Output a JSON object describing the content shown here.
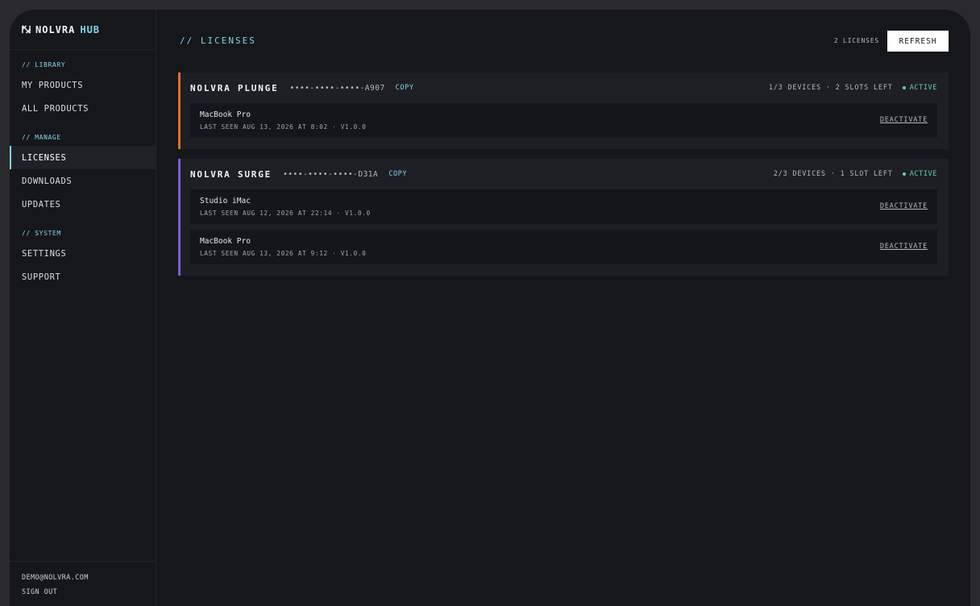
{
  "brand": {
    "name": "NOLVRA",
    "accent": "HUB"
  },
  "sidebar": {
    "sections": [
      {
        "label": "// LIBRARY",
        "items": [
          {
            "label": "MY PRODUCTS"
          },
          {
            "label": "ALL PRODUCTS"
          }
        ]
      },
      {
        "label": "// MANAGE",
        "items": [
          {
            "label": "LICENSES",
            "active": true
          },
          {
            "label": "DOWNLOADS"
          },
          {
            "label": "UPDATES"
          }
        ]
      },
      {
        "label": "// SYSTEM",
        "items": [
          {
            "label": "SETTINGS"
          },
          {
            "label": "SUPPORT"
          }
        ]
      }
    ],
    "footer": {
      "email": "DEMO@NOLVRA.COM",
      "sign_out": "SIGN OUT"
    }
  },
  "header": {
    "title": "//  LICENSES",
    "count": "2 LICENSES",
    "refresh_label": "REFRESH"
  },
  "licenses": [
    {
      "name": "NOLVRA PLUNGE",
      "key": "••••-••••-••••-A907",
      "copy": "COPY",
      "devices": "1/3 DEVICES · 2 SLOTS LEFT",
      "status": "ACTIVE",
      "color": "#e0712c",
      "device_list": [
        {
          "name": "MacBook Pro",
          "info": "LAST SEEN AUG 13, 2026 AT 8:02 · V1.0.0",
          "action": "DEACTIVATE"
        }
      ]
    },
    {
      "name": "NOLVRA SURGE",
      "key": "••••-••••-••••-D31A",
      "copy": "COPY",
      "devices": "2/3 DEVICES · 1 SLOT LEFT",
      "status": "ACTIVE",
      "color": "#7b5ed6",
      "device_list": [
        {
          "name": "Studio iMac",
          "info": "LAST SEEN AUG 12, 2026 AT 22:14 · V1.0.0",
          "action": "DEACTIVATE"
        },
        {
          "name": "MacBook Pro",
          "info": "LAST SEEN AUG 13, 2026 AT 9:12 · V1.0.0",
          "action": "DEACTIVATE"
        }
      ]
    }
  ],
  "colors": {
    "accent": "#7fd4ea",
    "active": "#5fd3a2",
    "background": "#16171b"
  },
  "icons": {
    "brand": "nolvra-logo-icon",
    "status": "status-dot-icon"
  }
}
